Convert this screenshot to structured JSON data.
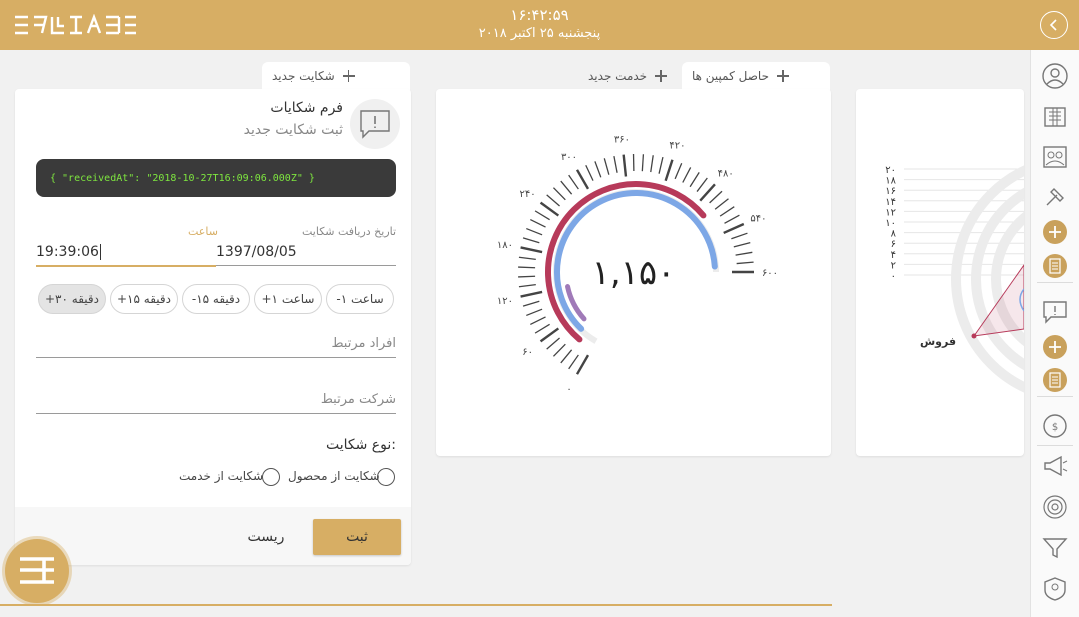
{
  "header": {
    "time": "۱۶:۴۲:۵۹",
    "date": "پنجشنبه ۲۵ اکتبر ۲۰۱۸"
  },
  "tabs": [
    {
      "label": "شکایت جدید"
    },
    {
      "label": "خدمت جدید"
    },
    {
      "label": "حاصل کمپین ها"
    }
  ],
  "form": {
    "title": "فرم شکایات",
    "subtitle": "ثبت شکایت جدید",
    "json_preview": "{ \"receivedAt\": \"2018-10-27T16:09:06.000Z\" }",
    "date_label": "تاریخ دریافت شکایت",
    "date_value": "1397/08/05",
    "time_label": "ساعت",
    "time_value": "19:39:06",
    "chips": [
      "-۱ ساعت",
      "+۱ ساعت",
      "-۱۵ دقیقه",
      "+۱۵ دقیقه",
      "+۳۰ دقیقه"
    ],
    "related_people_placeholder": "افراد مرتبط",
    "related_company_placeholder": "شرکت مرتبط",
    "complaint_type_label": "نوع شکایت:",
    "radio_product": "شکایت از محصول",
    "radio_service": "شکایت از خدمت",
    "submit_label": "ثبت",
    "reset_label": "ریست"
  },
  "gauge": {
    "value_display": "۱,۱۵۰",
    "value": 1150,
    "tick_labels": [
      "۰",
      "۶۰",
      "۱۲۰",
      "۱۸۰",
      "۲۴۰",
      "۳۰۰",
      "۳۶۰",
      "۴۲۰",
      "۴۸۰",
      "۵۴۰",
      "۶۰۰"
    ]
  },
  "radar": {
    "axis_labels": [
      "۲۰",
      "۱۸",
      "۱۶",
      "۱۴",
      "۱۲",
      "۱۰",
      "۸",
      "۶",
      "۴",
      "۲",
      "۰"
    ],
    "category_label": "فروش"
  },
  "sidebar": {
    "icons": [
      "users-icon",
      "building-icon",
      "meeting-icon",
      "hammer-icon",
      "add-icon",
      "document-icon",
      "complaint-icon",
      "add-icon",
      "document-icon",
      "dollar-icon",
      "megaphone-icon",
      "target-icon",
      "filter-icon",
      "badge-icon"
    ]
  },
  "colors": {
    "accent": "#d7ae64",
    "gauge_outer": "#b73a5a",
    "gauge_inner": "#7da7e6"
  }
}
